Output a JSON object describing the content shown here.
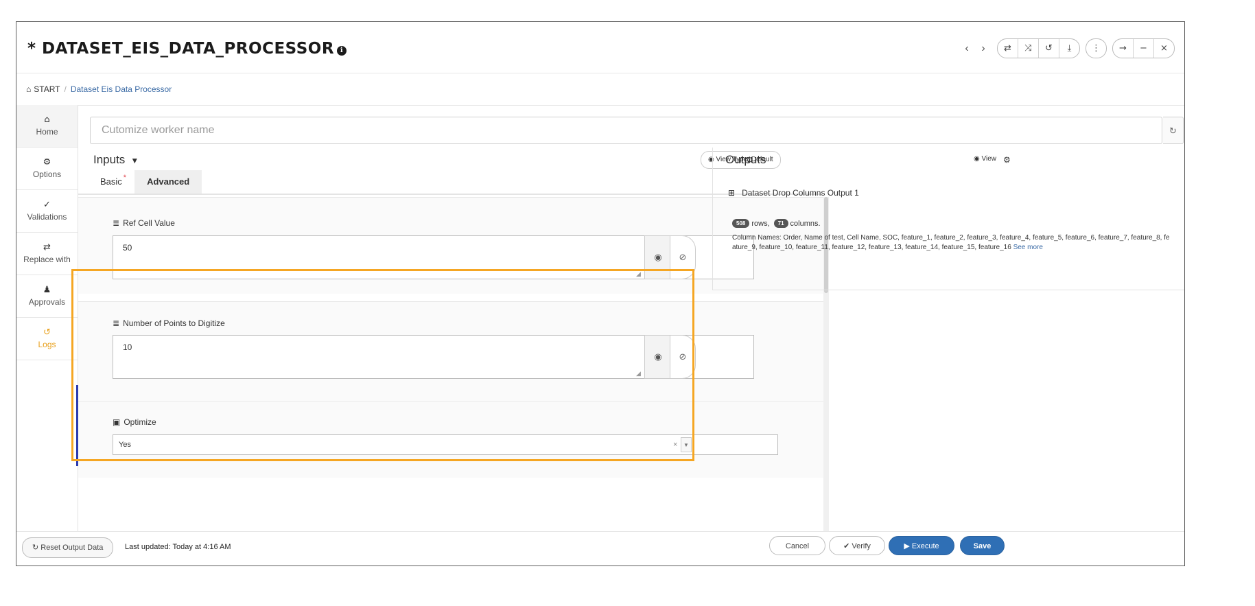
{
  "header": {
    "title": "* DATASET_EIS_DATA_PROCESSOR",
    "nav_prev": "‹",
    "nav_next": "›",
    "tool_buttons": [
      "⇄",
      "⤨",
      "↺",
      "⤓"
    ],
    "more_button": "⋮",
    "window_buttons": [
      "→",
      "−",
      "×"
    ]
  },
  "breadcrumb": {
    "root": "START",
    "separator": "/",
    "current": "Dataset Eis Data Processor"
  },
  "sidebar": {
    "items": [
      {
        "label": "Home",
        "icon": "home-icon",
        "glyph": "⌂"
      },
      {
        "label": "Options",
        "icon": "gear-icon",
        "glyph": "⚙"
      },
      {
        "label": "Validations",
        "icon": "check-icon",
        "glyph": "✓"
      },
      {
        "label": "Replace with",
        "icon": "swap-icon",
        "glyph": "⇄"
      },
      {
        "label": "Approvals",
        "icon": "user-check-icon",
        "glyph": "👤"
      },
      {
        "label": "Logs",
        "icon": "history-icon",
        "glyph": "↺"
      }
    ],
    "active_index": 5,
    "active_color": "#e8a01c"
  },
  "worker": {
    "placeholder": "Cutomize worker name"
  },
  "inputs": {
    "title": "Inputs",
    "view_type_label": "View Type: Default",
    "tabs": [
      {
        "label": "Basic",
        "required_marker": "*"
      },
      {
        "label": "Advanced",
        "required_marker": ""
      }
    ],
    "active_tab": "Advanced",
    "fields": {
      "ref_cell_value": {
        "label": "Ref Cell Value",
        "value": "50"
      },
      "num_points": {
        "label": "Number of Points to Digitize",
        "value": "10"
      },
      "optimize": {
        "label": "Optimize",
        "value": "Yes"
      }
    },
    "highlight_color": "#f5a623"
  },
  "outputs": {
    "title": "Outputs",
    "view_label": "View",
    "item_label": "Dataset Drop Columns Output 1",
    "rows": "508",
    "rows_word": "rows,",
    "columns": "71",
    "columns_word": "columns.",
    "column_names": "Column Names: Order, Name of test, Cell Name, SOC, feature_1, feature_2, feature_3, feature_4, feature_5, feature_6, feature_7, feature_8, feature_9, feature_10, feature_11, feature_12, feature_13, feature_14, feature_15, feature_16",
    "see_more": "See more"
  },
  "footer": {
    "reset_label": "Reset Output Data",
    "last_updated": "Last updated: Today at 4:16 AM",
    "cancel_label": "Cancel",
    "verify_label": "Verify",
    "execute_label": "Execute",
    "save_label": "Save",
    "primary_color": "#2f6fb5"
  }
}
